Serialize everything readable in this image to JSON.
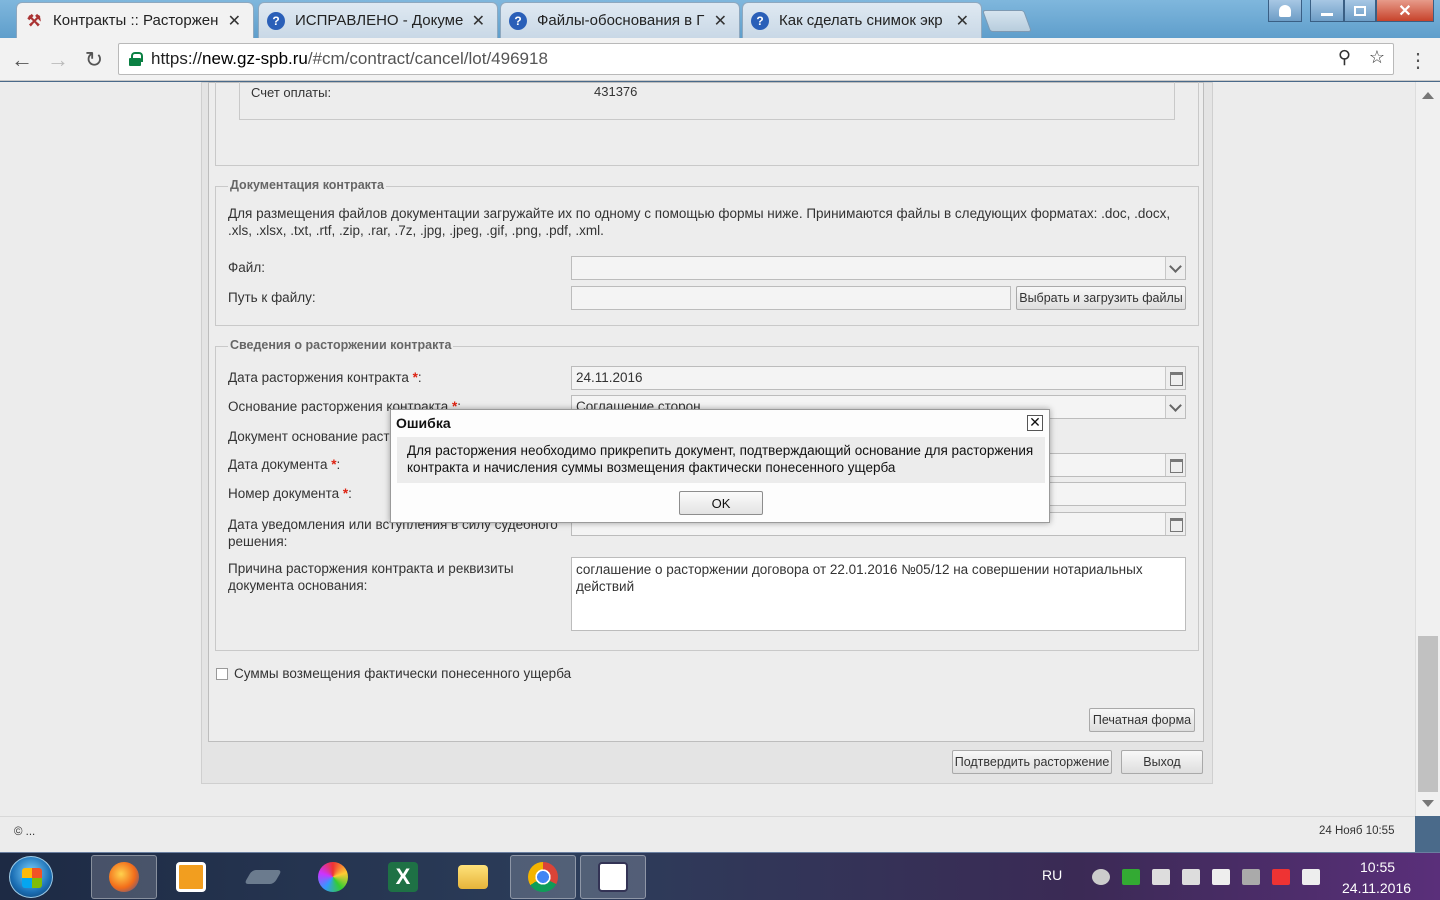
{
  "browser": {
    "tabs": [
      {
        "title": "Контракты :: Расторжен",
        "icon": "tools-icon",
        "active": true
      },
      {
        "title": "ИСПРАВЛЕНО - Докуме",
        "icon": "help-icon",
        "active": false
      },
      {
        "title": "Файлы-обоснования в Г",
        "icon": "help-icon",
        "active": false
      },
      {
        "title": "Как сделать снимок экр",
        "icon": "help-icon",
        "active": false
      }
    ],
    "tab_close_glyph": "✕",
    "url_scheme": "https://",
    "url_host": "new.gz-spb.ru",
    "url_path": "/#cm/contract/cancel/lot/496918"
  },
  "payment": {
    "account_label": "Счет оплаты:",
    "account_value": "431376"
  },
  "docs_section": {
    "legend": "Документация контракта",
    "instructions": "Для размещения файлов документации загружайте их по одному с помощью формы ниже. Принимаются файлы в следующих форматах: .doc, .docx, .xls, .xlsx, .txt, .rtf, .zip, .rar, .7z, .jpg, .jpeg, .gif, .png, .pdf, .xml.",
    "file_label": "Файл:",
    "file_value": "",
    "path_label": "Путь к файлу:",
    "path_value": "",
    "upload_button": "Выбрать и загрузить файлы"
  },
  "cancel_section": {
    "legend": "Сведения о расторжении контракта",
    "date_label": "Дата расторжения контракта",
    "date_value": "24.11.2016",
    "reason_label": "Основание расторжения контракта",
    "reason_value": "Соглашение сторон",
    "basis_doc_label": "Документ основание расто",
    "doc_date_label": "Дата документа",
    "doc_number_label": "Номер документа",
    "notice_date_label_line1": "Дата уведомления или вступления в силу судебного",
    "notice_date_label_line2": "решения:",
    "cause_label_line1": "Причина расторжения контракта и реквизиты",
    "cause_label_line2": "документа основания:",
    "cause_value": "соглашение о расторжении договора от 22.01.2016 №05/12 на совершении нотариальных действий",
    "required_mark": "*",
    "colon": ":"
  },
  "damages_checkbox_label": "Суммы возмещения фактически понесенного ущерба",
  "buttons": {
    "print_form": "Печатная форма",
    "confirm": "Подтвердить расторжение",
    "exit": "Выход"
  },
  "footer": {
    "copyright": "© ...",
    "datetime": "24 Нояб 10:55"
  },
  "modal": {
    "title": "Ошибка",
    "message": "Для расторжения необходимо прикрепить документ, подтверждающий основание для расторжения контракта и начисления суммы возмещения фактически понесенного ущерба",
    "ok": "OK",
    "close_glyph": "✕"
  },
  "taskbar": {
    "lang": "RU",
    "time": "10:55",
    "date": "24.11.2016"
  }
}
